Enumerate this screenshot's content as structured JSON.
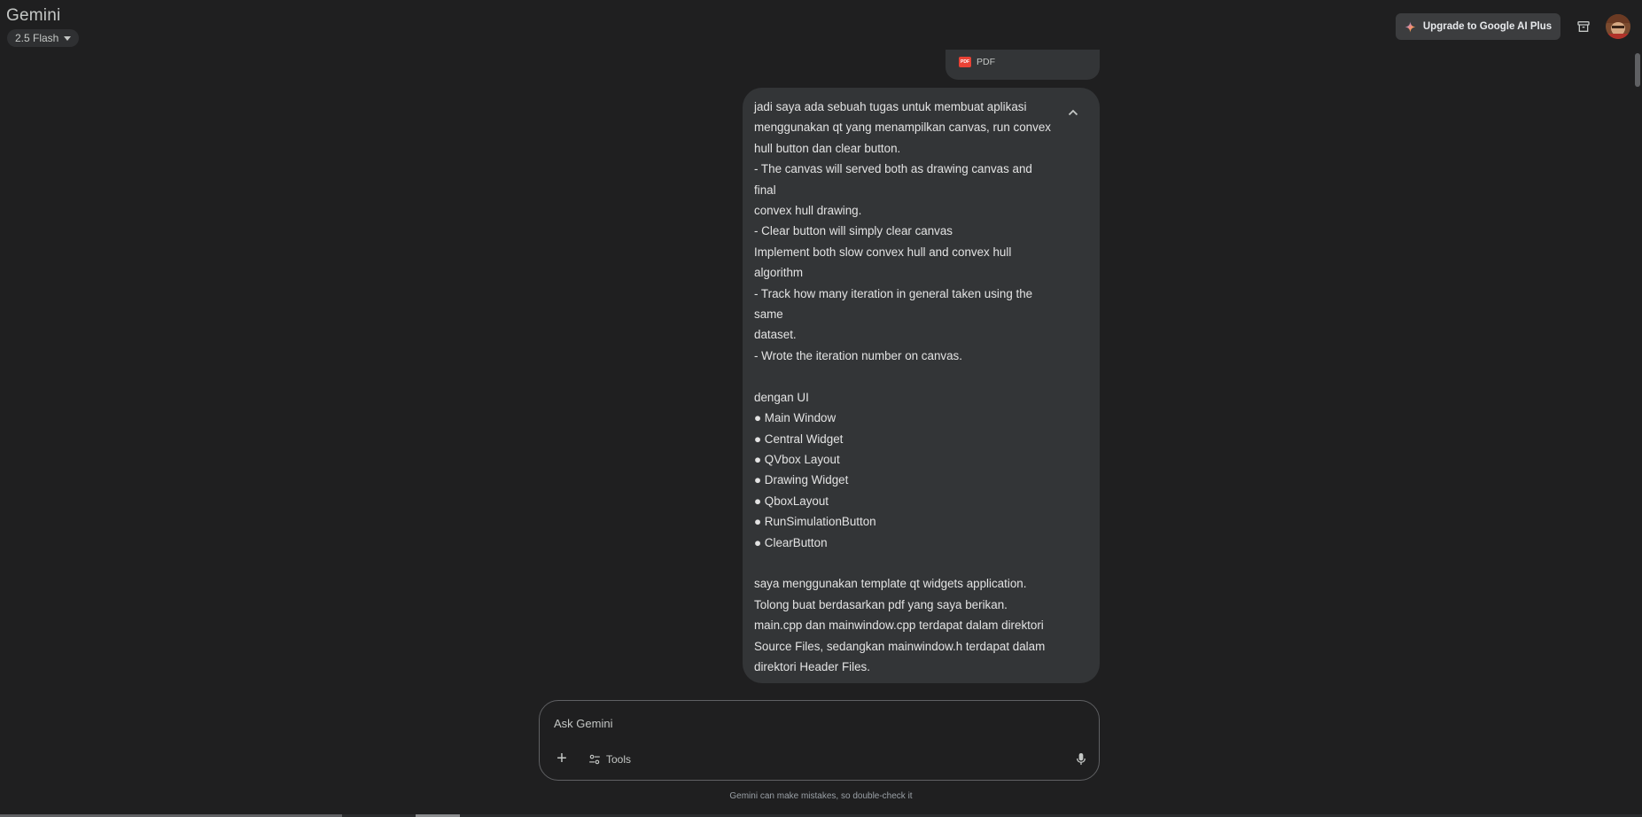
{
  "app": {
    "title": "Gemini",
    "model_label": "2.5 Flash"
  },
  "header": {
    "upgrade_label": "Upgrade to Google AI Plus"
  },
  "attachment": {
    "label": "PDF",
    "badge_text": "PDF"
  },
  "message": {
    "text": "jadi saya ada sebuah tugas untuk membuat aplikasi\nmenggunakan qt yang menampilkan canvas, run convex\nhull button dan clear button.\n- The canvas will served both as drawing canvas and\nfinal\nconvex hull drawing.\n- Clear button will simply clear canvas\nImplement both slow convex hull and convex hull\nalgorithm\n- Track how many iteration in general taken using the\nsame\ndataset.\n- Wrote the iteration number on canvas.\n\ndengan UI\n● Main Window\n● Central Widget\n● QVbox Layout\n● Drawing Widget\n● QboxLayout\n● RunSimulationButton\n● ClearButton\n\nsaya menggunakan template qt widgets application.\nTolong buat berdasarkan pdf yang saya berikan.\nmain.cpp dan mainwindow.cpp terdapat dalam direktori\nSource Files, sedangkan mainwindow.h terdapat dalam\ndirektori Header Files."
  },
  "composer": {
    "placeholder": "Ask Gemini",
    "tools_label": "Tools",
    "plus_label": "+"
  },
  "footer": {
    "disclaimer": "Gemini can make mistakes, so double-check it"
  },
  "icons": {
    "sparkle": "sparkle-icon",
    "archive": "archive-icon",
    "collapse": "chevron-up-icon",
    "tools": "tune-icon",
    "mic": "mic-icon"
  },
  "colors": {
    "background": "#1f1f20",
    "bubble": "#333537",
    "text": "#e3e3e3",
    "upgrade_button": "#3c3d3f"
  }
}
